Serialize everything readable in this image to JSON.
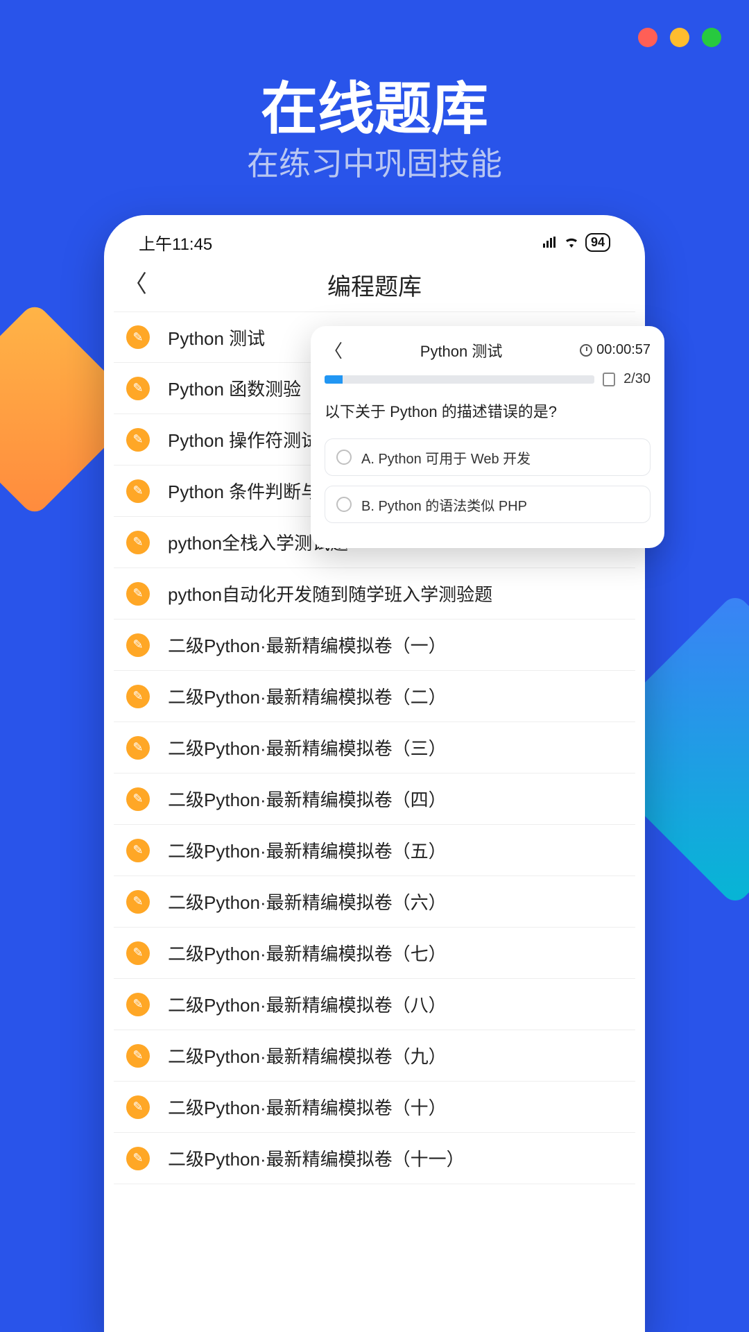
{
  "window_dots": {
    "colors": [
      "#FF5F56",
      "#FFBD2E",
      "#27C93F"
    ]
  },
  "hero": {
    "title": "在线题库",
    "subtitle": "在练习中巩固技能"
  },
  "statusbar": {
    "time": "上午11:45",
    "battery": "94"
  },
  "phone_header": {
    "title": "编程题库"
  },
  "list_items": [
    {
      "label": "Python 测试"
    },
    {
      "label": "Python 函数测验"
    },
    {
      "label": "Python 操作符测试"
    },
    {
      "label": "Python 条件判断与循环测试"
    },
    {
      "label": "python全栈入学测试题"
    },
    {
      "label": "python自动化开发随到随学班入学测验题"
    },
    {
      "label": "二级Python·最新精编模拟卷（一）"
    },
    {
      "label": "二级Python·最新精编模拟卷（二）"
    },
    {
      "label": "二级Python·最新精编模拟卷（三）"
    },
    {
      "label": "二级Python·最新精编模拟卷（四）"
    },
    {
      "label": "二级Python·最新精编模拟卷（五）"
    },
    {
      "label": "二级Python·最新精编模拟卷（六）"
    },
    {
      "label": "二级Python·最新精编模拟卷（七）"
    },
    {
      "label": "二级Python·最新精编模拟卷（八）"
    },
    {
      "label": "二级Python·最新精编模拟卷（九）"
    },
    {
      "label": "二级Python·最新精编模拟卷（十）"
    },
    {
      "label": "二级Python·最新精编模拟卷（十一）"
    }
  ],
  "popup": {
    "title": "Python 测试",
    "timer": "00:00:57",
    "progress": "2/30",
    "question": "以下关于 Python 的描述错误的是?",
    "options": [
      {
        "text": "A. Python 可用于 Web 开发"
      },
      {
        "text": "B. Python 的语法类似 PHP"
      }
    ]
  }
}
